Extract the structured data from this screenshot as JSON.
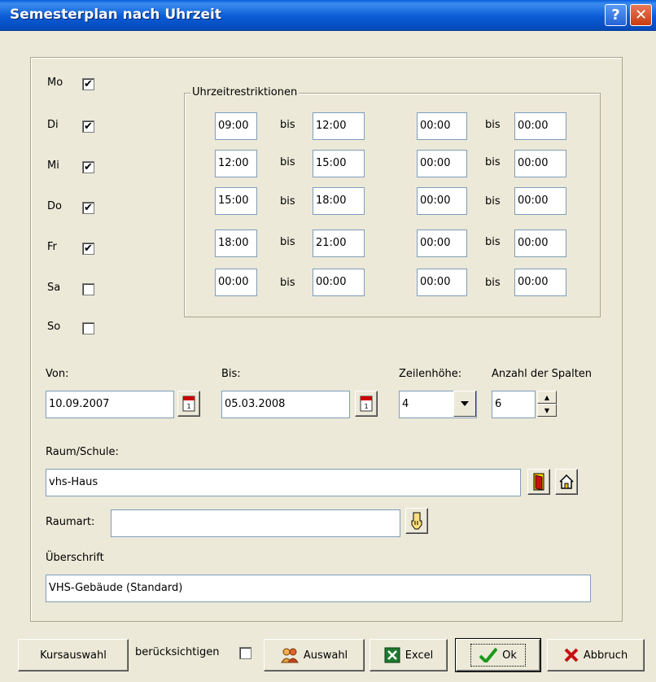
{
  "window": {
    "title": "Semesterplan nach Uhrzeit",
    "help_icon": "?",
    "close_icon": "✕"
  },
  "days": [
    {
      "label": "Mo",
      "checked": true
    },
    {
      "label": "Di",
      "checked": true
    },
    {
      "label": "Mi",
      "checked": true
    },
    {
      "label": "Do",
      "checked": true
    },
    {
      "label": "Fr",
      "checked": true
    },
    {
      "label": "Sa",
      "checked": false
    },
    {
      "label": "So",
      "checked": false
    }
  ],
  "time_restrictions": {
    "title": "Uhrzeitrestriktionen",
    "sep": "bis",
    "rows": [
      {
        "a_from": "09:00",
        "a_to": "12:00",
        "b_from": "00:00",
        "b_to": "00:00"
      },
      {
        "a_from": "12:00",
        "a_to": "15:00",
        "b_from": "00:00",
        "b_to": "00:00"
      },
      {
        "a_from": "15:00",
        "a_to": "18:00",
        "b_from": "00:00",
        "b_to": "00:00"
      },
      {
        "a_from": "18:00",
        "a_to": "21:00",
        "b_from": "00:00",
        "b_to": "00:00"
      },
      {
        "a_from": "00:00",
        "a_to": "00:00",
        "b_from": "00:00",
        "b_to": "00:00"
      }
    ]
  },
  "range": {
    "von_label": "Von:",
    "von_value": "10.09.2007",
    "bis_label": "Bis:",
    "bis_value": "05.03.2008",
    "zeilenhoehe_label": "Zeilenhöhe:",
    "zeilenhoehe_value": "4",
    "spalten_label": "Anzahl der Spalten",
    "spalten_value": "6"
  },
  "raum": {
    "label": "Raum/Schule:",
    "value": "vhs-Haus"
  },
  "raumart": {
    "label": "Raumart:",
    "value": ""
  },
  "ueberschrift": {
    "label": "Überschrift",
    "value": "VHS-Gebäude (Standard)"
  },
  "footer": {
    "kursauswahl": "Kursauswahl",
    "beruecksichtigen": "berücksichtigen",
    "beruecksichtigen_checked": false,
    "auswahl": "Auswahl",
    "excel": "Excel",
    "ok": "Ok",
    "abbruch": "Abbruch"
  },
  "colors": {
    "titlebar": "#0a5cd6",
    "dialog_bg": "#ece9d8",
    "field_border": "#7f9db9"
  }
}
